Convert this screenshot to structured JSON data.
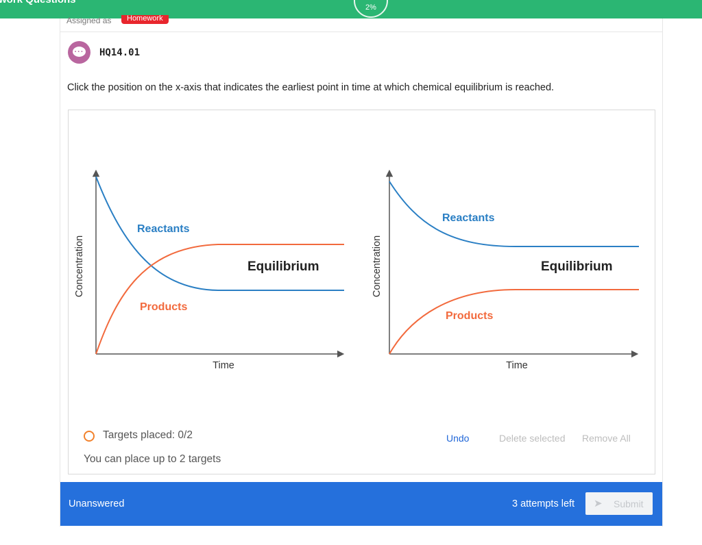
{
  "header": {
    "title": "work Questions",
    "progress": "2%"
  },
  "question": {
    "assigned_label": "Assigned as",
    "assignment_type": "Homework",
    "id": "HQ14.01",
    "prompt": "Click the position on the x-axis that indicates the earliest point in time at which chemical equilibrium is reached."
  },
  "graphs": [
    {
      "ylabel": "Concentration",
      "xlabel": "Time",
      "reactants_label": "Reactants",
      "products_label": "Products",
      "equilibrium_label": "Equilibrium"
    },
    {
      "ylabel": "Concentration",
      "xlabel": "Time",
      "reactants_label": "Reactants",
      "products_label": "Products",
      "equilibrium_label": "Equilibrium"
    }
  ],
  "colors": {
    "reactants": "#2a7fc4",
    "products": "#f26a3d",
    "axis": "#555555"
  },
  "targets": {
    "status": "Targets placed: 0/2",
    "hint": "You can place up to 2 targets",
    "placed": 0,
    "max": 2
  },
  "controls": {
    "undo": "Undo",
    "delete_selected": "Delete selected",
    "remove_all": "Remove All"
  },
  "footer": {
    "status": "Unanswered",
    "attempts": "3 attempts left",
    "submit": "Submit"
  }
}
